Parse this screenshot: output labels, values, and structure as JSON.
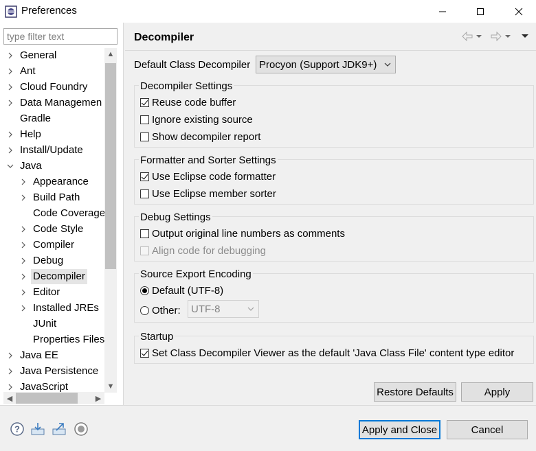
{
  "window": {
    "title": "Preferences"
  },
  "filter": {
    "placeholder": "type filter text"
  },
  "tree": {
    "items": [
      {
        "label": "General",
        "level": 0,
        "expandable": true
      },
      {
        "label": "Ant",
        "level": 0,
        "expandable": true
      },
      {
        "label": "Cloud Foundry",
        "level": 0,
        "expandable": true
      },
      {
        "label": "Data Managemen",
        "level": 0,
        "expandable": true
      },
      {
        "label": "Gradle",
        "level": 0,
        "expandable": false
      },
      {
        "label": "Help",
        "level": 0,
        "expandable": true
      },
      {
        "label": "Install/Update",
        "level": 0,
        "expandable": true
      },
      {
        "label": "Java",
        "level": 0,
        "expandable": true,
        "expanded": true
      },
      {
        "label": "Appearance",
        "level": 1,
        "expandable": true
      },
      {
        "label": "Build Path",
        "level": 1,
        "expandable": true
      },
      {
        "label": "Code Coverage",
        "level": 1,
        "expandable": false
      },
      {
        "label": "Code Style",
        "level": 1,
        "expandable": true
      },
      {
        "label": "Compiler",
        "level": 1,
        "expandable": true
      },
      {
        "label": "Debug",
        "level": 1,
        "expandable": true
      },
      {
        "label": "Decompiler",
        "level": 1,
        "expandable": true,
        "selected": true
      },
      {
        "label": "Editor",
        "level": 1,
        "expandable": true
      },
      {
        "label": "Installed JREs",
        "level": 1,
        "expandable": true
      },
      {
        "label": "JUnit",
        "level": 1,
        "expandable": false
      },
      {
        "label": "Properties Files",
        "level": 1,
        "expandable": false
      },
      {
        "label": "Java EE",
        "level": 0,
        "expandable": true
      },
      {
        "label": "Java Persistence",
        "level": 0,
        "expandable": true
      },
      {
        "label": "JavaScript",
        "level": 0,
        "expandable": true
      }
    ]
  },
  "page": {
    "title": "Decompiler",
    "default_decompiler_label": "Default Class Decompiler",
    "default_decompiler_value": "Procyon (Support JDK9+)",
    "groups": {
      "decompiler_settings": {
        "title": "Decompiler Settings",
        "options": [
          {
            "label": "Reuse code buffer",
            "checked": true
          },
          {
            "label": "Ignore existing source",
            "checked": false
          },
          {
            "label": "Show decompiler report",
            "checked": false
          }
        ]
      },
      "formatter": {
        "title": "Formatter and Sorter Settings",
        "options": [
          {
            "label": "Use Eclipse code formatter",
            "checked": true
          },
          {
            "label": "Use Eclipse member sorter",
            "checked": false
          }
        ]
      },
      "debug": {
        "title": "Debug Settings",
        "options": [
          {
            "label": "Output original line numbers as comments",
            "checked": false
          },
          {
            "label": "Align code for debugging",
            "checked": false,
            "disabled": true
          }
        ]
      },
      "encoding": {
        "title": "Source Export Encoding",
        "default_label": "Default (UTF-8)",
        "other_label": "Other:",
        "other_value": "UTF-8",
        "selected": "default"
      },
      "startup": {
        "title": "Startup",
        "option_label": "Set Class Decompiler Viewer as the default 'Java Class File' content type editor",
        "checked": true
      }
    },
    "restore_defaults_label": "Restore Defaults",
    "apply_label": "Apply"
  },
  "footer": {
    "apply_close_label": "Apply and Close",
    "cancel_label": "Cancel",
    "icons": [
      "help-icon",
      "import-icon",
      "export-icon",
      "record-icon"
    ]
  },
  "colors": {
    "accent": "#0078d7",
    "selection": "#e5e5e5"
  }
}
